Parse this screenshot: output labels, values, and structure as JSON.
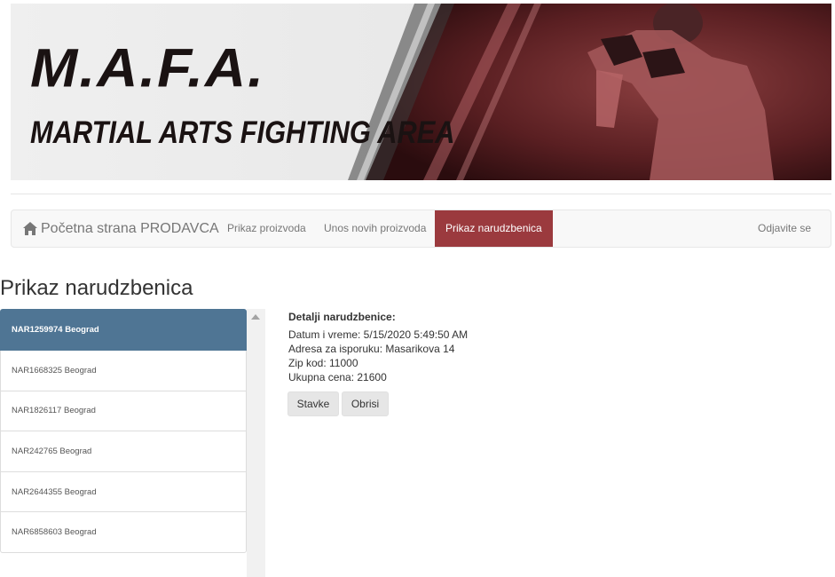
{
  "banner": {
    "title": "M.A.F.A.",
    "subtitle": "MARTIAL ARTS FIGHTING AREA"
  },
  "navbar": {
    "brand_icon": "home-icon",
    "brand_label": "Početna strana PRODAVCA",
    "links": [
      {
        "label": "Prikaz proizvoda"
      },
      {
        "label": "Unos novih proizvoda"
      },
      {
        "label": "Prikaz narudzbenica",
        "active": true
      }
    ],
    "logout_label": "Odjavite se"
  },
  "page": {
    "heading": "Prikaz narudzbenica"
  },
  "orders": [
    {
      "label": "NAR1259974 Beograd",
      "selected": true
    },
    {
      "label": "NAR1668325 Beograd"
    },
    {
      "label": "NAR1826117 Beograd"
    },
    {
      "label": "NAR242765 Beograd"
    },
    {
      "label": "NAR2644355 Beograd"
    },
    {
      "label": "NAR6858603 Beograd"
    }
  ],
  "details": {
    "title": "Detalji narudzbenice:",
    "datetime": "Datum i vreme: 5/15/2020 5:49:50 AM",
    "address": "Adresa za isporuku: Masarikova 14",
    "zip": "Zip kod: 11000",
    "total": "Ukupna cena: 21600",
    "items_button": "Stavke",
    "delete_button": "Obrisi"
  },
  "colors": {
    "active_nav": "#9b3a3e",
    "selected_item": "#4f7594",
    "banner_dark": "#3a1416"
  }
}
